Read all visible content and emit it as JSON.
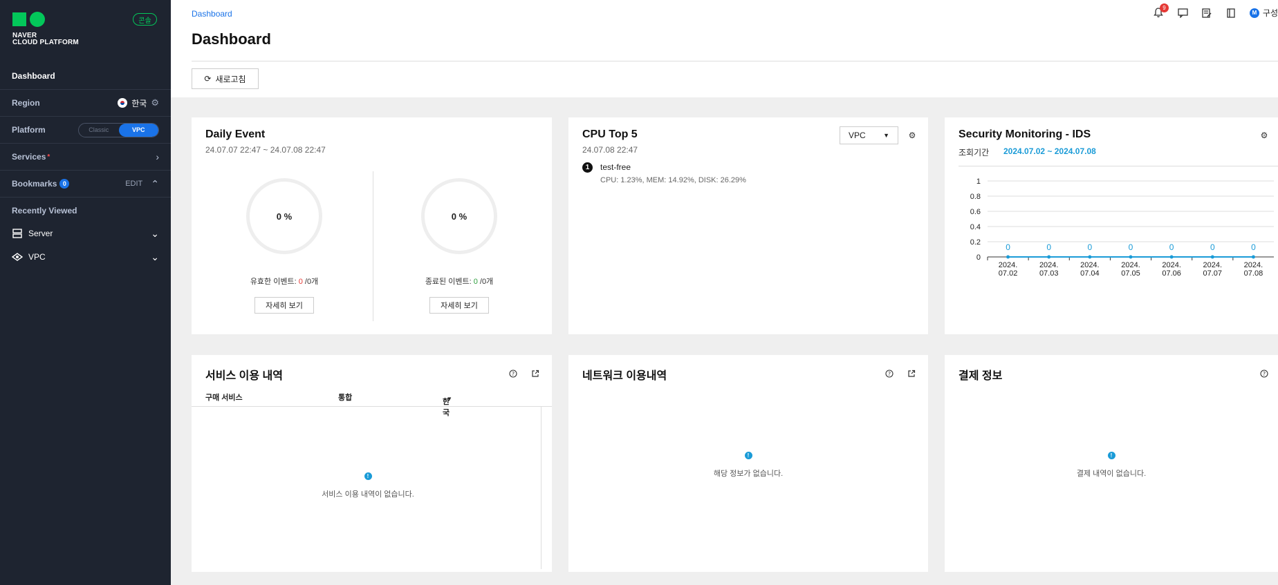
{
  "brand": {
    "line1": "NAVER",
    "line2": "CLOUD PLATFORM",
    "console_badge": "콘솔"
  },
  "sidebar": {
    "dashboard": "Dashboard",
    "region_label": "Region",
    "region_value": "한국",
    "platform_label": "Platform",
    "platform_options": [
      "Classic",
      "VPC"
    ],
    "services_label": "Services",
    "services_marker": "*",
    "bookmarks_label": "Bookmarks",
    "bookmarks_count": "0",
    "bookmarks_edit": "EDIT",
    "recent_title": "Recently Viewed",
    "recent_items": [
      "Server",
      "VPC"
    ]
  },
  "header": {
    "breadcrumb": "Dashboard",
    "title": "Dashboard",
    "refresh_label": "새로고침",
    "notification_count": "9",
    "user_name": "구성",
    "user_initial": "M"
  },
  "daily_event": {
    "title": "Daily Event",
    "period": "24.07.07 22:47 ~ 24.07.08 22:47",
    "active_pct": "0 %",
    "ended_pct": "0 %",
    "active_label": "유효한 이벤트: ",
    "active_count": "0",
    "active_total": " /0개",
    "ended_label": "종료된 이벤트: ",
    "ended_count": "0",
    "ended_total": " /0개",
    "detail_label": "자세히 보기"
  },
  "cpu_top": {
    "title": "CPU Top 5",
    "timestamp": "24.07.08 22:47",
    "select_value": "VPC",
    "rank": "1",
    "server_name": "test-free",
    "server_detail": "CPU: 1.23%, MEM: 14.92%, DISK: 26.29%"
  },
  "security": {
    "title": "Security Monitoring - IDS",
    "period_label": "조회기간",
    "period_value": "2024.07.02 ~ 2024.07.08"
  },
  "chart_data": {
    "type": "line",
    "categories": [
      "2024.\n07.02",
      "2024.\n07.03",
      "2024.\n07.04",
      "2024.\n07.05",
      "2024.\n07.06",
      "2024.\n07.07",
      "2024.\n07.08"
    ],
    "values": [
      0,
      0,
      0,
      0,
      0,
      0,
      0
    ],
    "ylim": [
      0,
      1
    ],
    "yticks": [
      "0",
      "0.2",
      "0.4",
      "0.6",
      "0.8",
      "1"
    ],
    "grid": true,
    "colors": {
      "line": "#1a9bd7"
    }
  },
  "service_usage": {
    "title": "서비스 이용 내역",
    "columns": [
      "구매 서비스",
      "통합",
      "한국"
    ],
    "empty_text": "서비스 이용 내역이 없습니다."
  },
  "network_usage": {
    "title": "네트워크 이용내역",
    "empty_text": "해당 정보가 없습니다."
  },
  "payment": {
    "title": "결제 정보",
    "empty_text": "결제 내역이 없습니다."
  }
}
